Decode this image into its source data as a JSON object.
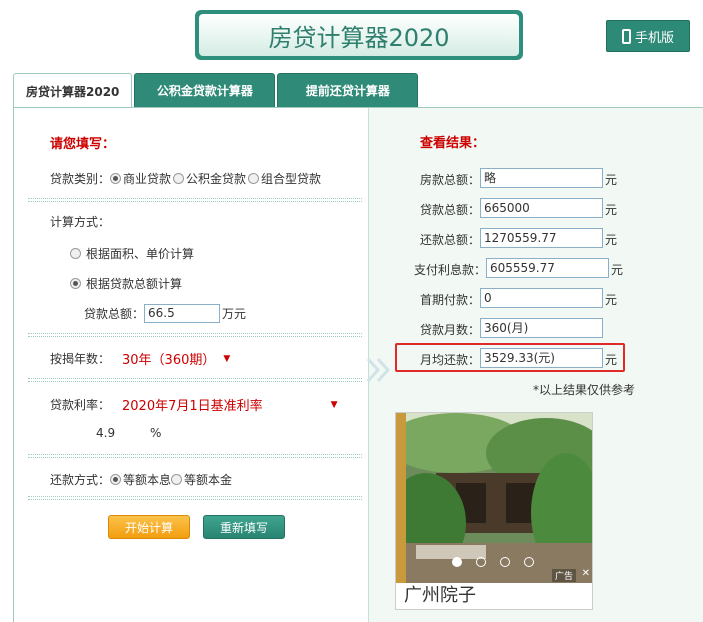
{
  "header": {
    "title": "房贷计算器2020",
    "mobile_label": "手机版"
  },
  "tabs": [
    {
      "label": "房贷计算器2020",
      "active": true
    },
    {
      "label": "公积金贷款计算器"
    },
    {
      "label": "提前还贷计算器"
    }
  ],
  "form": {
    "title": "请您填写：",
    "loan_type_label": "贷款类别：",
    "loan_types": [
      "商业贷款",
      "公积金贷款",
      "组合型贷款"
    ],
    "calc_method_label": "计算方式：",
    "calc_methods": [
      "根据面积、单价计算",
      "根据贷款总额计算"
    ],
    "loan_total_label": "贷款总额：",
    "loan_total_value": "66.5",
    "loan_total_unit": "万元",
    "years_label": "按揭年数：",
    "years_value": "30年（360期）",
    "rate_label": "贷款利率：",
    "rate_option": "2020年7月1日基准利率",
    "rate_value": "4.9",
    "rate_unit": "%",
    "repay_label": "还款方式：",
    "repay_methods": [
      "等额本息",
      "等额本金"
    ],
    "start_btn": "开始计算",
    "reset_btn": "重新填写"
  },
  "results": {
    "title": "查看结果：",
    "rows": [
      {
        "label": "房款总额：",
        "value": "略",
        "unit": "元"
      },
      {
        "label": "贷款总额：",
        "value": "665000",
        "unit": "元"
      },
      {
        "label": "还款总额：",
        "value": "1270559.77",
        "unit": "元"
      },
      {
        "label": "支付利息款：",
        "value": "605559.77",
        "unit": "元"
      },
      {
        "label": "首期付款：",
        "value": "0",
        "unit": "元"
      },
      {
        "label": "贷款月数：",
        "value": "360(月)",
        "unit": ""
      },
      {
        "label": "月均还款：",
        "value": "3529.33(元)",
        "unit": "元"
      }
    ],
    "note": "*以上结果仅供参考"
  },
  "ad": {
    "caption": "广州院子",
    "tag": "广告",
    "close": "✕"
  }
}
